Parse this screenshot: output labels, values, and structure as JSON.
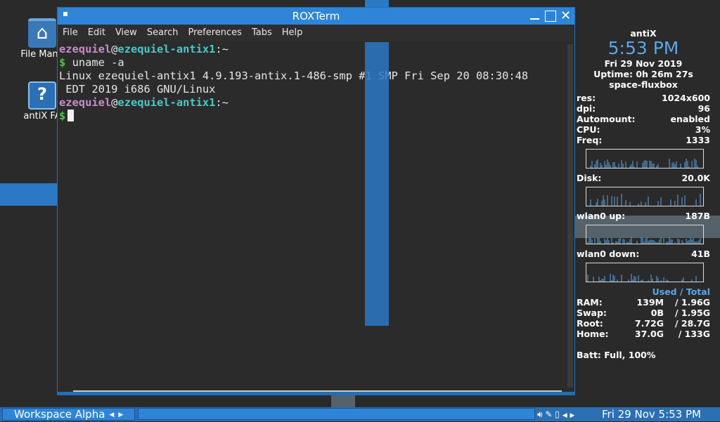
{
  "desktop": {
    "icons": [
      {
        "label": "File Mana"
      },
      {
        "label": "antiX FA"
      }
    ]
  },
  "terminal": {
    "title": "ROXTerm",
    "menu": [
      "File",
      "Edit",
      "View",
      "Search",
      "Preferences",
      "Tabs",
      "Help"
    ],
    "user": "ezequiel",
    "host": "ezequiel-antix1",
    "path": ":~",
    "prompt": "$",
    "command": "uname -a",
    "output_line1": "Linux ezequiel-antix1 4.9.193-antix.1-486-smp #1 SMP Fri Sep 20 08:30:48",
    "output_line2": " EDT 2019 i686 GNU/Linux"
  },
  "conky": {
    "hostname": "antiX",
    "time": "5:53 PM",
    "date": "Fri 29 Nov 2019",
    "uptime": "Uptime: 0h 26m 27s",
    "wm": "space-fluxbox",
    "stats": [
      {
        "label": "res:",
        "value": "1024x600"
      },
      {
        "label": "dpi:",
        "value": "96"
      },
      {
        "label": "Automount:",
        "value": "enabled"
      },
      {
        "label": "CPU:",
        "value": "3%"
      },
      {
        "label": "Freq:",
        "value": "1333"
      }
    ],
    "disk": {
      "label": "Disk:",
      "value": "20.0K"
    },
    "wlan_up": {
      "label": "wlan0 up:",
      "value": "187B"
    },
    "wlan_down": {
      "label": "wlan0 down:",
      "value": "41B"
    },
    "usage_header": "Used / Total",
    "usage": [
      {
        "label": "RAM:",
        "used": "139M",
        "total": "/ 1.96G"
      },
      {
        "label": "Swap:",
        "used": "0B",
        "total": "/ 1.95G"
      },
      {
        "label": "Root:",
        "used": "7.72G",
        "total": "/ 28.7G"
      },
      {
        "label": "Home:",
        "used": "37.0G",
        "total": "/ 133G"
      }
    ],
    "battery": "Batt: Full, 100%"
  },
  "taskbar": {
    "workspace": "Workspace Alpha",
    "clock": "Fri 29 Nov   5:53 PM"
  },
  "colors": {
    "accent": "#2e85d8",
    "conky_highlight": "#5aa6e8"
  }
}
